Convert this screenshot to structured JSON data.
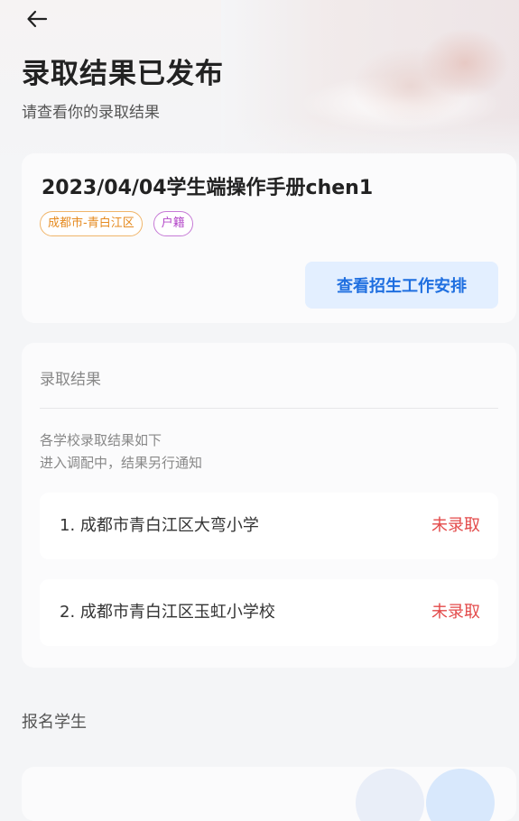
{
  "header": {
    "title": "录取结果已发布",
    "subtitle": "请查看你的录取结果"
  },
  "info_card": {
    "title": "2023/04/04学生端操作手册chen1",
    "tags": [
      "成都市-青白江区",
      "户籍"
    ],
    "schedule_button": "查看招生工作安排"
  },
  "result_card": {
    "heading": "录取结果",
    "desc_line1": "各学校录取结果如下",
    "desc_line2": "进入调配中，结果另行通知",
    "schools": [
      {
        "name": "1. 成都市青白江区大弯小学",
        "status": "未录取"
      },
      {
        "name": "2. 成都市青白江区玉虹小学校",
        "status": "未录取"
      }
    ]
  },
  "students_section": {
    "label": "报名学生"
  },
  "colors": {
    "accent_blue": "#1f6fe0",
    "status_red": "#e34a4a",
    "tag_orange": "#e58a1f",
    "tag_purple": "#b44ac9"
  },
  "icons": {
    "back": "arrow-left-icon"
  }
}
